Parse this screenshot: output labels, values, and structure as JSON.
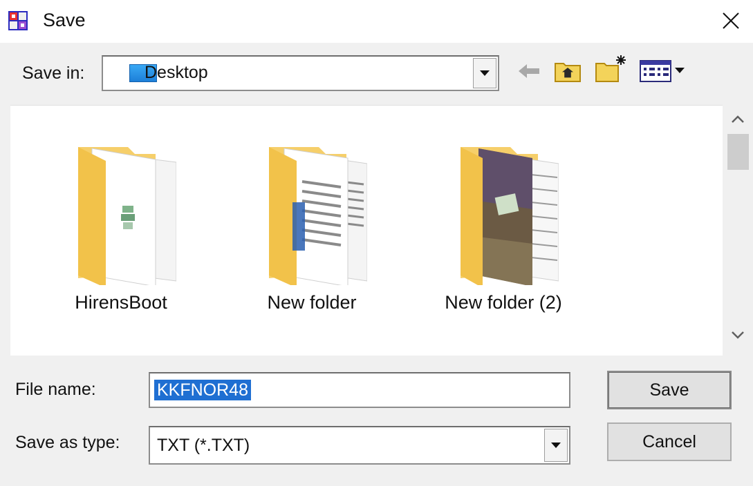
{
  "window": {
    "title": "Save",
    "app_icon": "app-icon",
    "close_icon": "close-icon"
  },
  "save_in": {
    "label": "Save in:",
    "value": "Desktop",
    "value_icon": "desktop-icon"
  },
  "toolbar": {
    "back": "back-arrow-icon",
    "up": "up-one-level-icon",
    "new_folder": "new-folder-icon",
    "views": "views-menu-icon"
  },
  "files": [
    {
      "name": "HirensBoot",
      "icon": "folder-icon"
    },
    {
      "name": "New folder",
      "icon": "folder-icon"
    },
    {
      "name": "New folder (2)",
      "icon": "folder-icon"
    }
  ],
  "file_name": {
    "label": "File name:",
    "value": "KKFNOR48"
  },
  "save_as_type": {
    "label": "Save as type:",
    "value": "TXT (*.TXT)"
  },
  "buttons": {
    "save": "Save",
    "cancel": "Cancel"
  }
}
